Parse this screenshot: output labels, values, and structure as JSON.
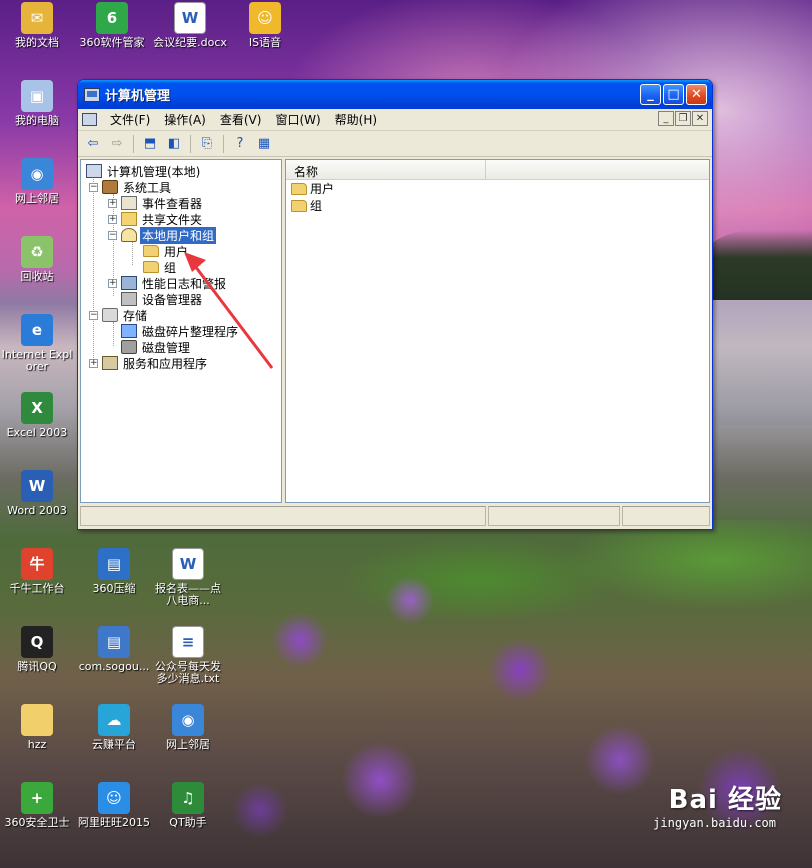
{
  "desktop": {
    "icons": [
      {
        "label": "我的文档",
        "icon": "my-documents-icon",
        "color": "#e6b43a",
        "glyph": "✉"
      },
      {
        "label": "360软件管家",
        "icon": "360-software-manager-icon",
        "color": "#2fa84a",
        "glyph": "6"
      },
      {
        "label": "会议纪要.docx",
        "icon": "docx-file-icon",
        "color": "#ffffff",
        "glyph": "W"
      },
      {
        "label": "IS语音",
        "icon": "is-voice-icon",
        "color": "#f0b92b",
        "glyph": "☺"
      },
      {
        "label": "我的电脑",
        "icon": "my-computer-icon",
        "color": "#a9c3e8",
        "glyph": "▣"
      },
      {
        "label": "网上邻居",
        "icon": "network-places-icon",
        "color": "#3a86d8",
        "glyph": "◉"
      },
      {
        "label": "回收站",
        "icon": "recycle-bin-icon",
        "color": "#8ac36a",
        "glyph": "♻"
      },
      {
        "label": "Internet Explorer",
        "icon": "internet-explorer-icon",
        "color": "#2b7bd8",
        "glyph": "e"
      },
      {
        "label": "Excel 2003",
        "icon": "excel-icon",
        "color": "#2f8a3e",
        "glyph": "X"
      },
      {
        "label": "Word 2003",
        "icon": "word-icon",
        "color": "#2b5fb5",
        "glyph": "W"
      },
      {
        "label": "千牛工作台",
        "icon": "qianniu-icon",
        "color": "#e0432d",
        "glyph": "牛"
      },
      {
        "label": "360压缩",
        "icon": "360-zip-icon",
        "color": "#2d70c8",
        "glyph": "▤"
      },
      {
        "label": "报名表——点八电商...",
        "icon": "doc-file-icon",
        "color": "#ffffff",
        "glyph": "W"
      },
      {
        "label": "腾讯QQ",
        "icon": "qq-icon",
        "color": "#222222",
        "glyph": "Q"
      },
      {
        "label": "com.sogou...",
        "icon": "sogou-archive-icon",
        "color": "#3f77c9",
        "glyph": "▤"
      },
      {
        "label": "公众号每天发多少消息.txt",
        "icon": "txt-file-icon",
        "color": "#ffffff",
        "glyph": "≡"
      },
      {
        "label": "hzz",
        "icon": "folder-icon",
        "color": "#f1cf6a",
        "glyph": ""
      },
      {
        "label": "云赚平台",
        "icon": "cloud-earn-icon",
        "color": "#27a4d8",
        "glyph": "☁"
      },
      {
        "label": "网上邻居",
        "icon": "network-places-icon",
        "color": "#3a86d8",
        "glyph": "◉"
      },
      {
        "label": "360安全卫士",
        "icon": "360-security-icon",
        "color": "#3aa83a",
        "glyph": "+"
      },
      {
        "label": "阿里旺旺2015",
        "icon": "aliwangwang-icon",
        "color": "#2a8ee6",
        "glyph": "☺"
      },
      {
        "label": "QT助手",
        "icon": "qt-assistant-icon",
        "color": "#2e8b3a",
        "glyph": "♫"
      }
    ]
  },
  "window": {
    "title": "计算机管理",
    "menu": [
      "文件(F)",
      "操作(A)",
      "查看(V)",
      "窗口(W)",
      "帮助(H)"
    ],
    "toolbar_icons": [
      "back-arrow-icon",
      "forward-arrow-icon",
      "up-folder-icon",
      "show-hide-tree-icon",
      "export-list-icon",
      "help-icon",
      "properties-icon"
    ],
    "tree": {
      "root": "计算机管理(本地)",
      "system_tools": "系统工具",
      "event_viewer": "事件查看器",
      "shared_folders": "共享文件夹",
      "local_users_groups": "本地用户和组",
      "users": "用户",
      "groups": "组",
      "perf_logs": "性能日志和警报",
      "device_manager": "设备管理器",
      "storage": "存储",
      "defrag": "磁盘碎片整理程序",
      "disk_mgmt": "磁盘管理",
      "services_apps": "服务和应用程序"
    },
    "list": {
      "column_name": "名称",
      "items": [
        "用户",
        "组"
      ]
    }
  },
  "annotation": {
    "color": "#e8383d"
  },
  "watermark": {
    "logo": "Bai  经验",
    "url": "jingyan.baidu.com"
  }
}
